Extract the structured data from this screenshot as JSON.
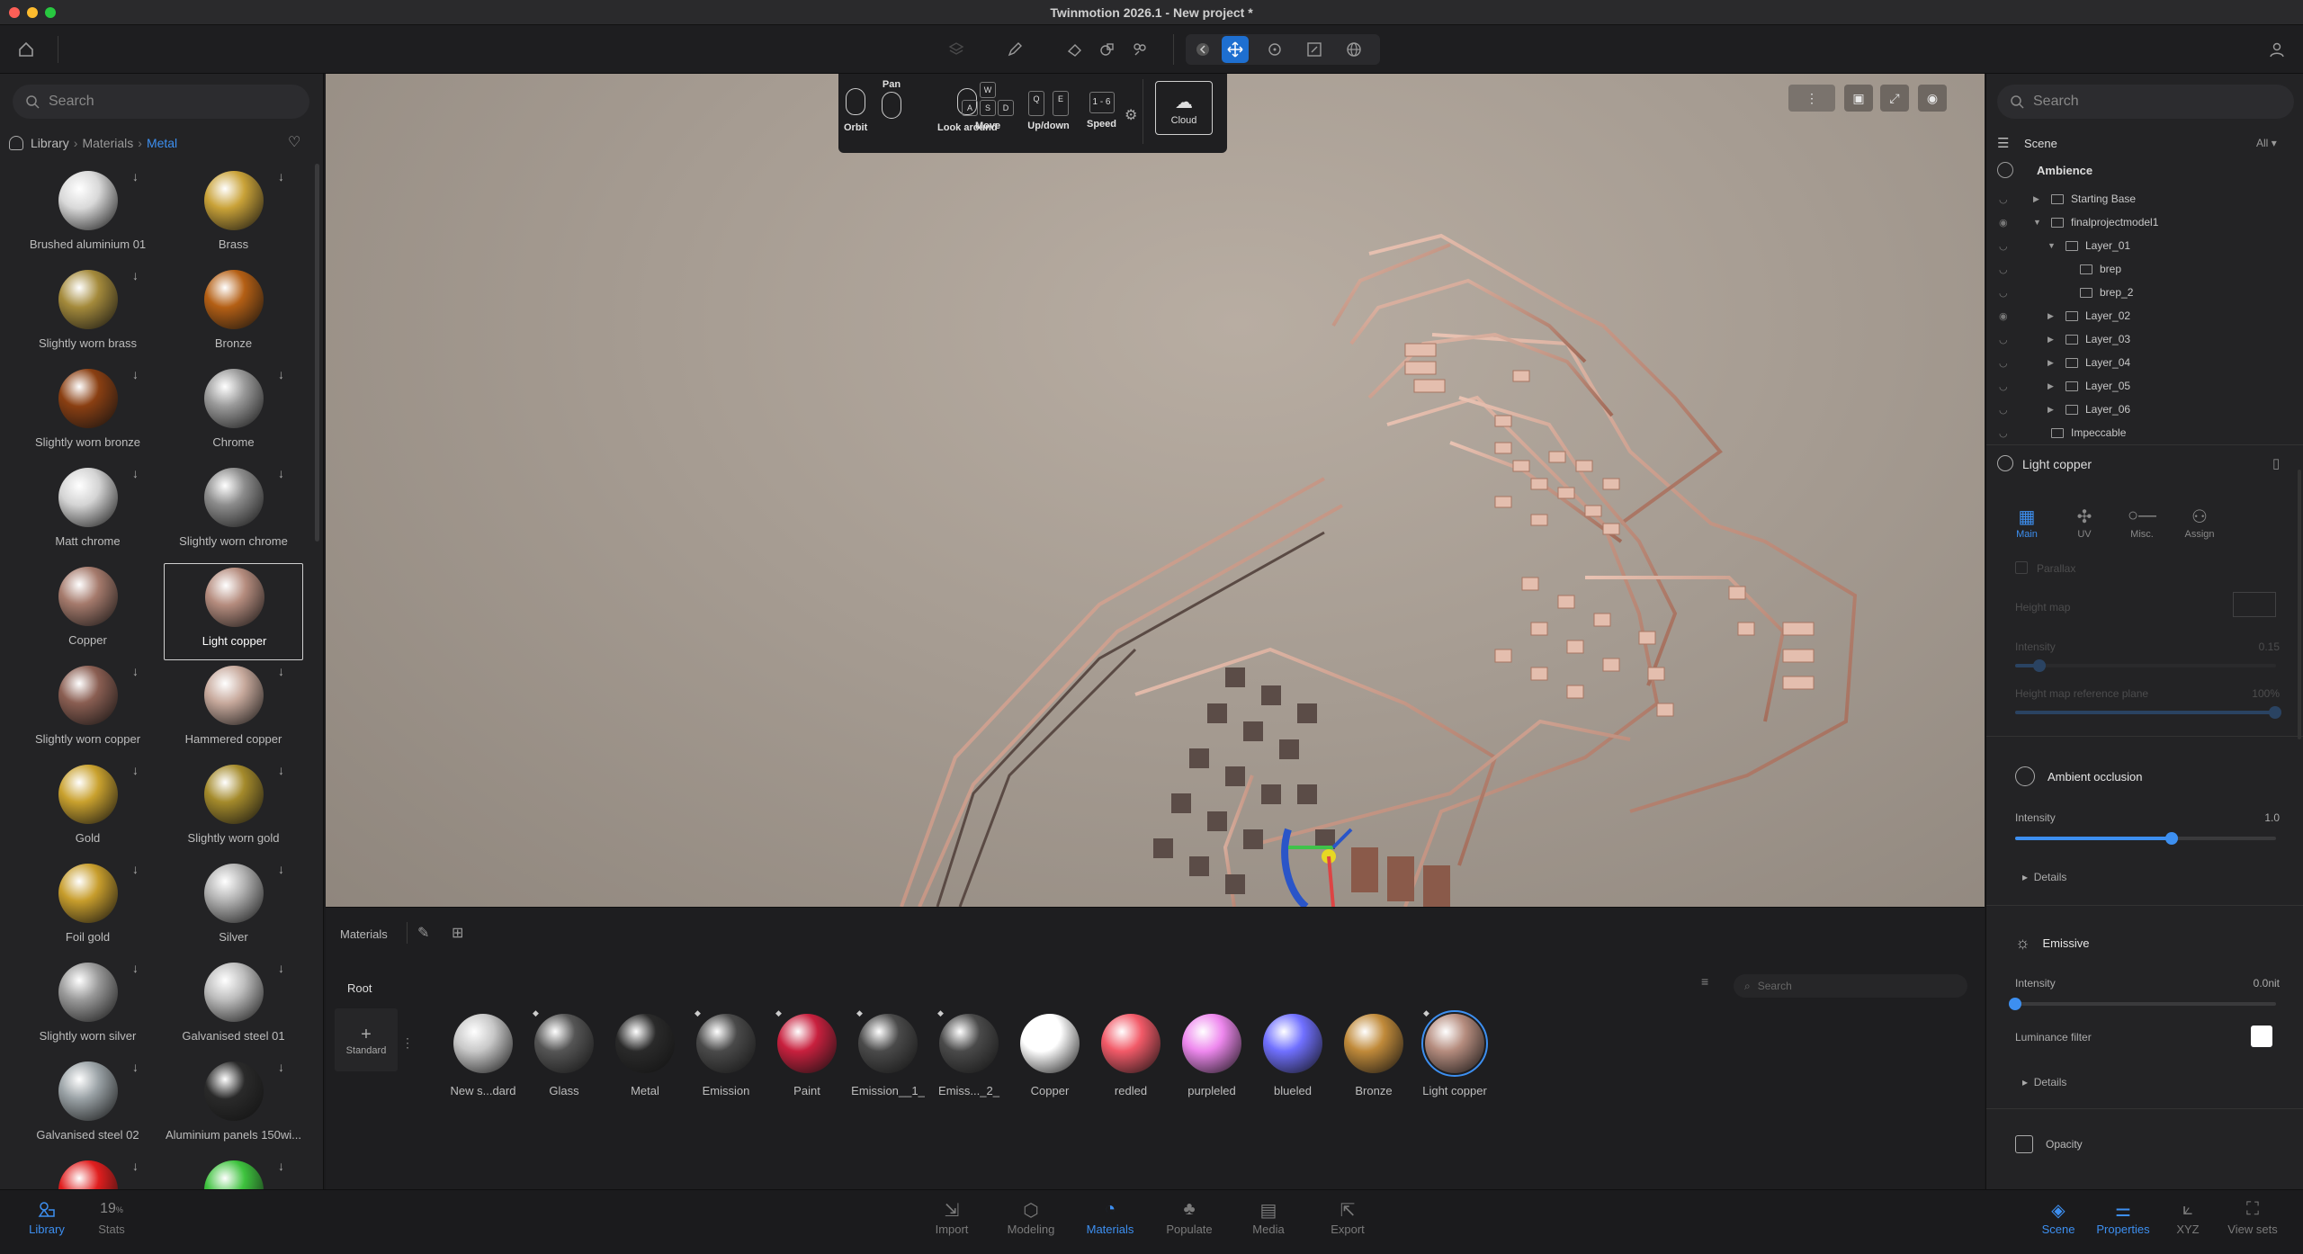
{
  "window": {
    "title": "Twinmotion 2026.1 - New project *"
  },
  "colors": {
    "accent": "#3d8ff0"
  },
  "left": {
    "search_placeholder": "Search",
    "breadcrumb": [
      "Library",
      "Materials",
      "Metal"
    ],
    "materials": [
      {
        "name": "Brushed aluminium 01",
        "color": "#d9d9d9",
        "download": true
      },
      {
        "name": "Brass",
        "color": "#c9a238",
        "download": true
      },
      {
        "name": "Slightly worn brass",
        "color": "#a48a3b",
        "download": true
      },
      {
        "name": "Bronze",
        "color": "#b45f14",
        "download": false
      },
      {
        "name": "Slightly worn bronze",
        "color": "#8a3f12",
        "download": true
      },
      {
        "name": "Chrome",
        "color": "#9a9a9a",
        "download": true
      },
      {
        "name": "Matt chrome",
        "color": "#d4d4d4",
        "download": true
      },
      {
        "name": "Slightly worn chrome",
        "color": "#8c8c8c",
        "download": true
      },
      {
        "name": "Copper",
        "color": "#a57a6c",
        "download": false
      },
      {
        "name": "Light copper",
        "color": "#b58c7e",
        "download": false
      },
      {
        "name": "Slightly worn copper",
        "color": "#8a5e52",
        "download": true
      },
      {
        "name": "Hammered copper",
        "color": "#c7a99c",
        "download": true
      },
      {
        "name": "Gold",
        "color": "#c9a12e",
        "download": true
      },
      {
        "name": "Slightly worn gold",
        "color": "#a48a2b",
        "download": true
      },
      {
        "name": "Foil gold",
        "color": "#c79d2c",
        "download": true
      },
      {
        "name": "Silver",
        "color": "#b2b2b2",
        "download": true
      },
      {
        "name": "Slightly worn silver",
        "color": "#999",
        "download": true
      },
      {
        "name": "Galvanised steel 01",
        "color": "#bdbdbd",
        "download": true
      },
      {
        "name": "Galvanised steel 02",
        "color": "#9aa2a6",
        "download": true
      },
      {
        "name": "Aluminium panels 150wi...",
        "color": "#2a2a2a",
        "download": true
      },
      {
        "name": "",
        "color": "#e01e1e",
        "download": true
      },
      {
        "name": "",
        "color": "#3ec23e",
        "download": true
      }
    ]
  },
  "viewport": {
    "nav": {
      "pan": "Pan",
      "orbit": "Orbit",
      "look_around": "Look around",
      "move": "Move",
      "updown": "Up/down",
      "speed": "Speed",
      "speed_range": "1 - 6",
      "cloud": "Cloud",
      "move_keys": [
        "W",
        "A",
        "S",
        "D"
      ],
      "updown_keys": [
        "Q",
        "E"
      ]
    }
  },
  "matbar": {
    "title": "Materials",
    "root": "Root",
    "search_placeholder": "Search",
    "standard_label": "Standard",
    "items": [
      {
        "name": "New s...dard",
        "color": "#c8c8c8",
        "badge": false
      },
      {
        "name": "Glass",
        "color": "#555",
        "badge": true
      },
      {
        "name": "Metal",
        "color": "#2a2a2a",
        "badge": false
      },
      {
        "name": "Emission",
        "color": "#4a4a4a",
        "badge": true
      },
      {
        "name": "Paint",
        "color": "#c8203e",
        "badge": true
      },
      {
        "name": "Emission__1_",
        "color": "#4a4a4a",
        "badge": true
      },
      {
        "name": "Emiss..._2_",
        "color": "#4a4a4a",
        "badge": true
      },
      {
        "name": "Copper",
        "color": "#ffffff",
        "badge": false
      },
      {
        "name": "redled",
        "color": "#f25a68",
        "badge": false
      },
      {
        "name": "purpleled",
        "color": "#ee88ee",
        "badge": false
      },
      {
        "name": "blueled",
        "color": "#7070ff",
        "badge": false
      },
      {
        "name": "Bronze",
        "color": "#c08a3a",
        "badge": false
      },
      {
        "name": "Light copper",
        "color": "#b58c7e",
        "badge": true
      }
    ]
  },
  "right": {
    "search_placeholder": "Search",
    "scene_title": "Scene",
    "filter": "All",
    "ambience": "Ambience",
    "tree": [
      {
        "label": "Starting Base",
        "indent": 1,
        "eye": false,
        "tri": "▶"
      },
      {
        "label": "finalprojectmodel1",
        "indent": 1,
        "eye": true,
        "tri": "▼"
      },
      {
        "label": "Layer_01",
        "indent": 2,
        "eye": false,
        "tri": "▼"
      },
      {
        "label": "brep",
        "indent": 3,
        "eye": false,
        "tri": ""
      },
      {
        "label": "brep_2",
        "indent": 3,
        "eye": false,
        "tri": ""
      },
      {
        "label": "Layer_02",
        "indent": 2,
        "eye": true,
        "tri": "▶"
      },
      {
        "label": "Layer_03",
        "indent": 2,
        "eye": false,
        "tri": "▶"
      },
      {
        "label": "Layer_04",
        "indent": 2,
        "eye": false,
        "tri": "▶"
      },
      {
        "label": "Layer_05",
        "indent": 2,
        "eye": false,
        "tri": "▶"
      },
      {
        "label": "Layer_06",
        "indent": 2,
        "eye": false,
        "tri": "▶"
      },
      {
        "label": "Impeccable",
        "indent": 1,
        "eye": false,
        "tri": ""
      }
    ],
    "material_name": "Light copper",
    "tabs": [
      "Main",
      "UV",
      "Misc.",
      "Assign"
    ],
    "parallax": "Parallax",
    "height_map": "Height map",
    "intensity": "Intensity",
    "parallax_intensity_val": "0.15",
    "hm_ref_plane": "Height map reference plane",
    "hm_ref_val": "100%",
    "ao_title": "Ambient occlusion",
    "ao_intensity_val": "1.0",
    "ao_level": 0.6,
    "details": "Details",
    "emissive_title": "Emissive",
    "emissive_val": "0.0nit",
    "emissive_level": 0.0,
    "luminance_filter": "Luminance filter",
    "opacity_title": "Opacity"
  },
  "statusbar": {
    "left_tabs": [
      {
        "label": "Library",
        "active": true
      },
      {
        "label": "Stats",
        "active": false,
        "value": "19"
      }
    ],
    "center_tabs": [
      {
        "label": "Import",
        "active": false
      },
      {
        "label": "Modeling",
        "active": false
      },
      {
        "label": "Materials",
        "active": true
      },
      {
        "label": "Populate",
        "active": false
      },
      {
        "label": "Media",
        "active": false
      },
      {
        "label": "Export",
        "active": false
      }
    ],
    "right_tabs": [
      {
        "label": "Scene",
        "active": true
      },
      {
        "label": "Properties",
        "active": true
      },
      {
        "label": "XYZ",
        "active": false
      },
      {
        "label": "View sets",
        "active": false
      }
    ],
    "stats_unit": "%"
  }
}
